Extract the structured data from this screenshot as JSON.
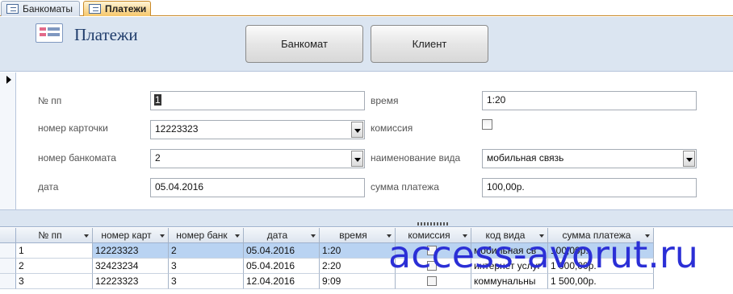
{
  "tabs": [
    {
      "label": "Банкоматы",
      "active": false
    },
    {
      "label": "Платежи",
      "active": true
    }
  ],
  "header": {
    "title": "Платежи",
    "buttons": [
      "Банкомат",
      "Клиент"
    ]
  },
  "form": {
    "labels": {
      "num": "№ пп",
      "card": "номер карточки",
      "atm": "номер банкомата",
      "date": "дата",
      "time": "время",
      "commission": "комиссия",
      "kind": "наименование вида",
      "amount": "сумма платежа"
    },
    "values": {
      "num": "1",
      "card": "12223323",
      "atm": "2",
      "date": "05.04.2016",
      "time": "1:20",
      "commission": false,
      "kind": "мобильная связь",
      "amount": "100,00р."
    }
  },
  "datasheet": {
    "columns": [
      "№ пп",
      "номер карт",
      "номер банк",
      "дата",
      "время",
      "комиссия",
      "код вида",
      "сумма платежа"
    ],
    "rows": [
      {
        "num": "1",
        "card": "12223323",
        "atm": "2",
        "date": "05.04.2016",
        "time": "1:20",
        "kind": "мобильная св",
        "amount": "100,00р."
      },
      {
        "num": "2",
        "card": "32423234",
        "atm": "3",
        "date": "05.04.2016",
        "time": "2:20",
        "kind": "интернет услуг",
        "amount": "1 000,00р."
      },
      {
        "num": "3",
        "card": "12223323",
        "atm": "3",
        "date": "12.04.2016",
        "time": "9:09",
        "kind": "коммунальны",
        "amount": "1 500,00р."
      }
    ]
  },
  "watermark": "access-avorut.ru",
  "colors": {
    "header_bg": "#dbe5f1",
    "active_tab": "#f6c76b",
    "selected_row": "#b9d3f2",
    "watermark": "#2b2fd6"
  }
}
